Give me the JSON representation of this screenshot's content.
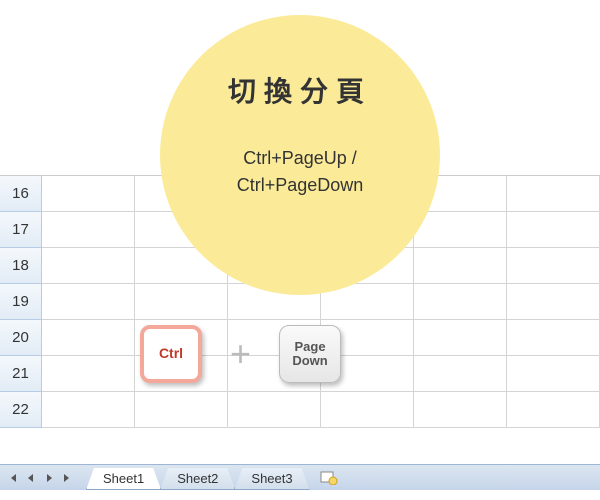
{
  "overlay": {
    "title": "切換分頁",
    "line1": "Ctrl+PageUp /",
    "line2": "Ctrl+PageDown"
  },
  "keys": {
    "ctrl": "Ctrl",
    "plus": "+",
    "pagedown": "Page\nDown"
  },
  "rows": [
    "16",
    "17",
    "18",
    "19",
    "20",
    "21",
    "22"
  ],
  "tabs": {
    "sheet1": "Sheet1",
    "sheet2": "Sheet2",
    "sheet3": "Sheet3"
  }
}
